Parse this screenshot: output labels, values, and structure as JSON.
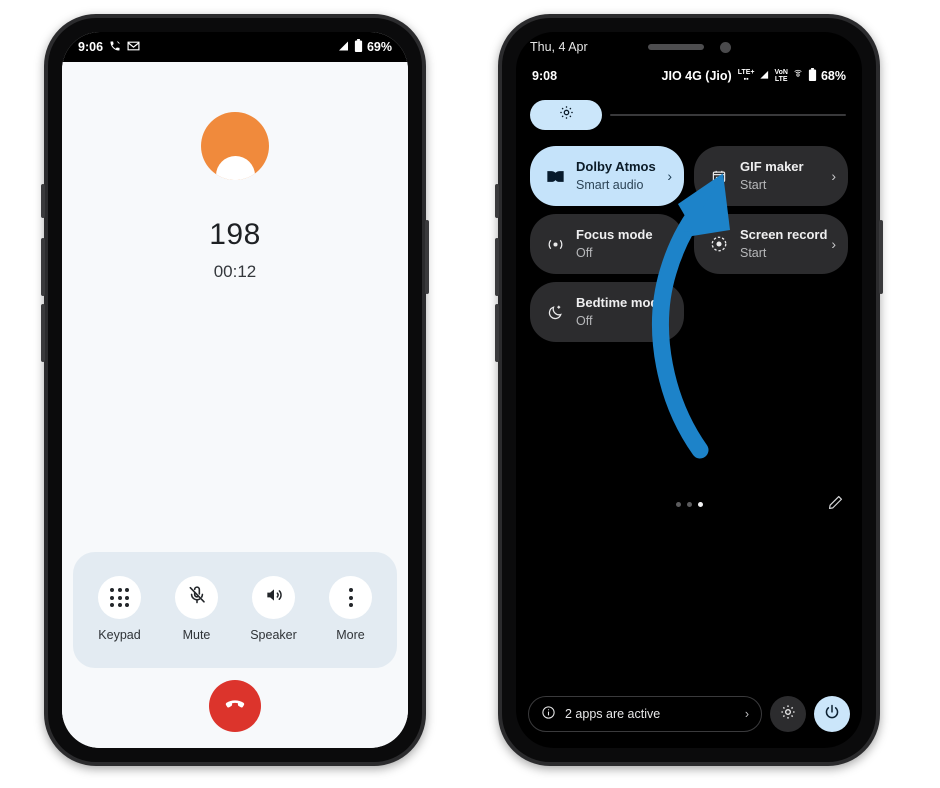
{
  "left_phone": {
    "status_bar": {
      "time": "9:06",
      "left_icons": [
        "phone-ring-icon",
        "gmail-icon"
      ],
      "signal_icon": "signal-bars-icon",
      "battery_icon": "battery-icon",
      "battery": "69%"
    },
    "call": {
      "avatar_icon": "contact-avatar-icon",
      "avatar_color": "#f08a3c",
      "number": "198",
      "duration": "00:12",
      "controls": [
        {
          "label": "Keypad",
          "icon": "keypad-grid-icon"
        },
        {
          "label": "Mute",
          "icon": "microphone-muted-icon"
        },
        {
          "label": "Speaker",
          "icon": "speaker-icon"
        },
        {
          "label": "More",
          "icon": "more-vertical-icon"
        }
      ],
      "end_call": {
        "icon": "end-call-icon",
        "color": "#dc342c"
      }
    }
  },
  "right_phone": {
    "date": "Thu, 4 Apr",
    "status_bar": {
      "time": "9:08",
      "carrier": "JIO 4G (Jio)",
      "icons": [
        "lte-plus-icon",
        "signal-bars-icon",
        "volte-icon",
        "wifi-hotspot-icon",
        "battery-icon"
      ],
      "battery": "68%"
    },
    "brightness": {
      "icon": "brightness-gear-icon",
      "pill_color": "#cbe6fa"
    },
    "tiles": [
      {
        "title": "Dolby Atmos",
        "sub": "Smart audio",
        "icon": "dolby-icon",
        "active": true,
        "chevron": "›"
      },
      {
        "title": "GIF maker",
        "sub": "Start",
        "icon": "gif-maker-icon",
        "active": false,
        "chevron": "›"
      },
      {
        "title": "Focus mode",
        "sub": "Off",
        "icon": "focus-mode-icon",
        "active": false,
        "chevron": ""
      },
      {
        "title": "Screen record",
        "sub": "Start",
        "icon": "screen-record-icon",
        "active": false,
        "chevron": "›"
      },
      {
        "title": "Bedtime mode",
        "sub": "Off",
        "icon": "bedtime-moon-icon",
        "active": false,
        "chevron": ""
      }
    ],
    "page_dots": {
      "count": 3,
      "active_index": 2
    },
    "edit_icon": "pencil-edit-icon",
    "footer": {
      "info_icon": "info-circle-icon",
      "apps_active_text": "2 apps are active",
      "chevron": "›",
      "settings_icon": "gear-icon",
      "power_icon": "power-icon"
    },
    "annotation": {
      "arrow_icon": "curved-arrow-annotation",
      "arrow_color": "#1d83c9",
      "points_to": "Screen record"
    }
  }
}
